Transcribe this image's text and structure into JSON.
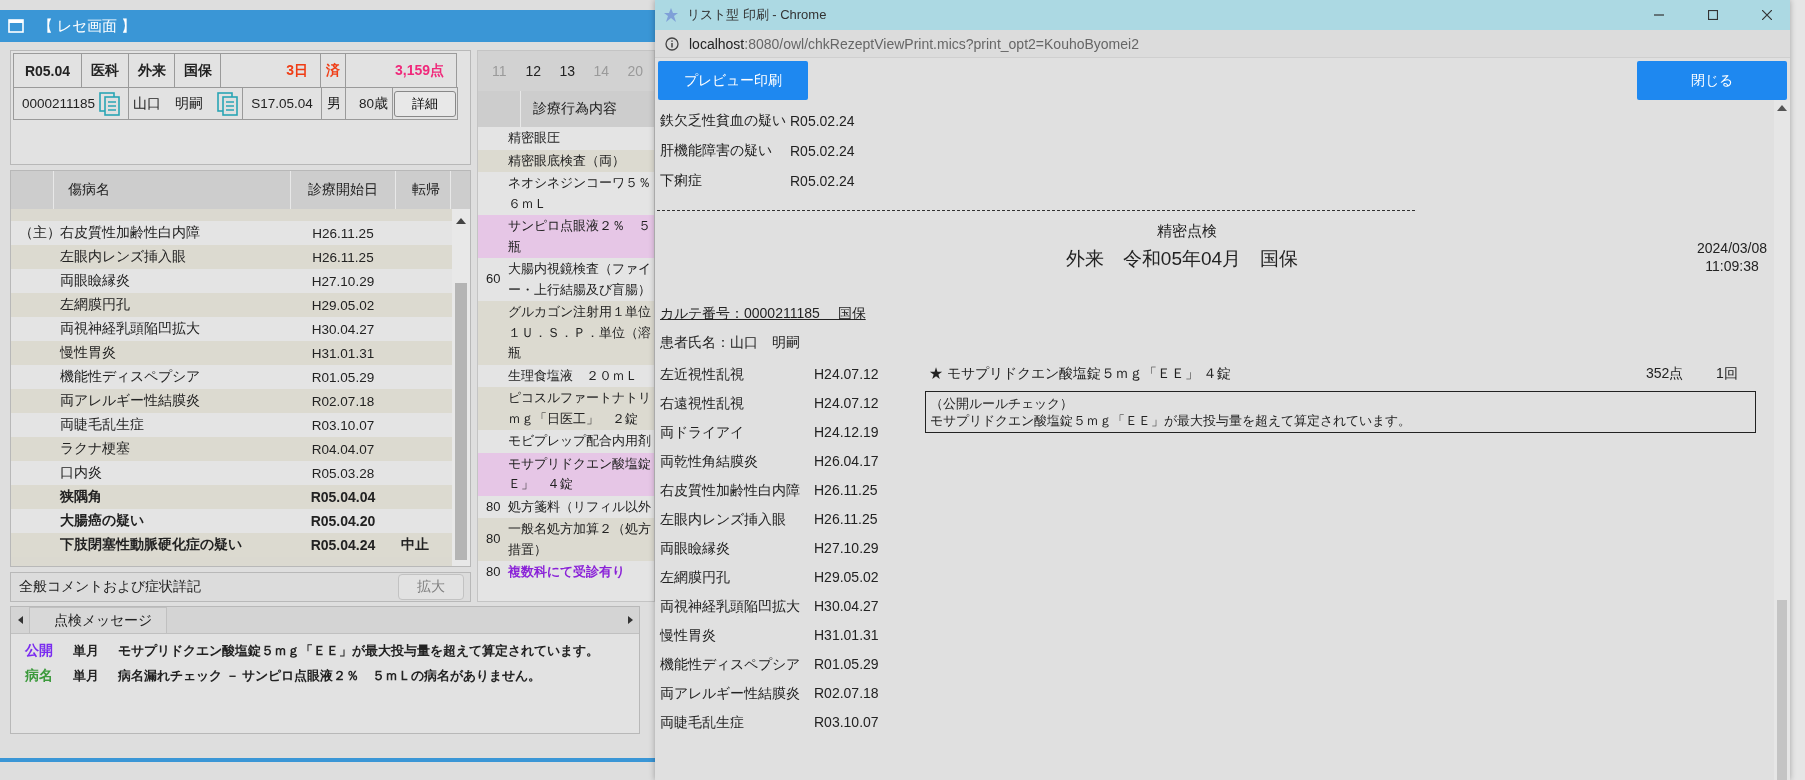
{
  "rece_window": {
    "title": "【 レセ画面 】",
    "header": {
      "month": "R05.04",
      "dept": "医科",
      "visit": "外来",
      "insurance": "国保",
      "days": "3日",
      "status": "済",
      "points": "3,159点",
      "patient_id": "0000211185",
      "patient_name": "山口　明嗣",
      "birth": "S17.05.04",
      "sex": "男",
      "age": "80歳",
      "detail_button": "詳細"
    },
    "diseases": {
      "columns": [
        "傷病名",
        "診療開始日",
        "転帰"
      ],
      "rows": [
        {
          "main": "（主）",
          "name": "右皮質性加齢性白内障",
          "start": "H26.11.25",
          "bold": false
        },
        {
          "name": "左眼内レンズ挿入眼",
          "start": "H26.11.25",
          "bold": false
        },
        {
          "name": "両眼瞼縁炎",
          "start": "H27.10.29",
          "bold": false
        },
        {
          "name": "左網膜円孔",
          "start": "H29.05.02",
          "bold": false
        },
        {
          "name": "両視神経乳頭陥凹拡大",
          "start": "H30.04.27",
          "bold": false
        },
        {
          "name": "慢性胃炎",
          "start": "H31.01.31",
          "bold": false
        },
        {
          "name": "機能性ディスペプシア",
          "start": "R01.05.29",
          "bold": false
        },
        {
          "name": "両アレルギー性結膜炎",
          "start": "R02.07.18",
          "bold": false
        },
        {
          "name": "両睫毛乱生症",
          "start": "R03.10.07",
          "bold": false
        },
        {
          "name": "ラクナ梗塞",
          "start": "R04.04.07",
          "bold": false
        },
        {
          "name": "口内炎",
          "start": "R05.03.28",
          "bold": false
        },
        {
          "name": "狭隅角",
          "start": "R05.04.04",
          "bold": true
        },
        {
          "name": "大腸癌の疑い",
          "start": "R05.04.20",
          "bold": true
        },
        {
          "name": "下肢閉塞性動脈硬化症の疑い",
          "start": "R05.04.24",
          "outcome": "中止",
          "bold": true
        }
      ]
    },
    "comment": {
      "label": "全般コメントおよび症状詳記",
      "button": "拡大",
      "disabled": true
    },
    "procedures": {
      "days": [
        {
          "label": "11",
          "active": false
        },
        {
          "label": "12",
          "active": true
        },
        {
          "label": "13",
          "active": true
        },
        {
          "label": "14",
          "active": false
        },
        {
          "label": "20",
          "active": false
        }
      ],
      "column": "診療行為内容",
      "items": [
        {
          "lines": [
            "精密眼圧"
          ],
          "highlighted": false,
          "emphasized": false
        },
        {
          "lines": [
            "精密眼底検査（両）"
          ],
          "highlighted": false,
          "emphasized": false
        },
        {
          "lines": [
            "ネオシネジンコーワ５％",
            "６ｍＬ"
          ],
          "highlighted": false,
          "emphasized": false
        },
        {
          "lines": [
            "サンピロ点眼液２％　５",
            "瓶"
          ],
          "highlighted": true,
          "emphasized": false
        },
        {
          "count": "60",
          "lines": [
            "大腸内視鏡検査（ファイ",
            "ー・上行結腸及び盲腸）"
          ],
          "highlighted": false,
          "emphasized": false
        },
        {
          "lines": [
            "グルカゴン注射用１単位",
            "１Ｕ．Ｓ．Ｐ．単位（溶",
            "瓶"
          ],
          "highlighted": false,
          "emphasized": false
        },
        {
          "lines": [
            "生理食塩液　２０ｍＬ"
          ],
          "highlighted": false,
          "emphasized": false
        },
        {
          "lines": [
            "ピコスルファートナトリ",
            "ｍｇ「日医工」　２錠"
          ],
          "highlighted": false,
          "emphasized": false
        },
        {
          "lines": [
            "モビプレップ配合内用剤"
          ],
          "highlighted": false,
          "emphasized": false
        },
        {
          "lines": [
            "モサプリドクエン酸塩錠",
            "Ｅ」　４錠"
          ],
          "highlighted": true,
          "emphasized": false
        },
        {
          "count": "80",
          "lines": [
            "処方箋料（リフィル以外"
          ],
          "highlighted": false,
          "emphasized": false
        },
        {
          "count": "80",
          "lines": [
            "一般名処方加算２（処方",
            "措置）"
          ],
          "highlighted": false,
          "emphasized": false
        },
        {
          "count": "80",
          "lines": [
            "複数科にて受診有り"
          ],
          "highlighted": false,
          "emphasized": true
        }
      ]
    },
    "messages": {
      "tab": "点検メッセージ",
      "items": [
        {
          "tag": "公開",
          "color": "#7a2cf0",
          "period": "単月",
          "text": "モサプリドクエン酸塩錠５ｍｇ「ＥＥ」が最大投与量を超えて算定されています。"
        },
        {
          "tag": "病名",
          "color": "#3c9a3c",
          "period": "単月",
          "text": "病名漏れチェック － サンピロ点眼液２％　５ｍＬの病名がありません。"
        }
      ]
    }
  },
  "print_window": {
    "title": "リスト型 印刷 - Chrome",
    "url_host": "localhost",
    "url_rest": ":8080/owl/chkRezeptViewPrint.mics?print_opt2=KouhoByomei2",
    "preview_button": "プレビュー印刷",
    "close_button": "閉じる",
    "earlier_diseases": [
      {
        "name": "鉄欠乏性貧血の疑い",
        "date": "R05.02.24"
      },
      {
        "name": "肝機能障害の疑い",
        "date": "R05.02.24"
      },
      {
        "name": "下痢症",
        "date": "R05.02.24"
      }
    ],
    "heading": "精密点検",
    "subheading": "外来　令和05年04月　国保",
    "print_date": "2024/03/08",
    "print_time": "11:09:38",
    "chart_number": "カルテ番号：0000211185　 国保",
    "patient": "患者氏名：山口　明嗣",
    "diseases": [
      {
        "name": "左近視性乱視",
        "date": "H24.07.12"
      },
      {
        "name": "右遠視性乱視",
        "date": "H24.07.12"
      },
      {
        "name": "両ドライアイ",
        "date": "H24.12.19"
      },
      {
        "name": "両乾性角結膜炎",
        "date": "H26.04.17"
      },
      {
        "name": "右皮質性加齢性白内障",
        "date": "H26.11.25"
      },
      {
        "name": "左眼内レンズ挿入眼",
        "date": "H26.11.25"
      },
      {
        "name": "両眼瞼縁炎",
        "date": "H27.10.29"
      },
      {
        "name": "左網膜円孔",
        "date": "H29.05.02"
      },
      {
        "name": "両視神経乳頭陥凹拡大",
        "date": "H30.04.27"
      },
      {
        "name": "慢性胃炎",
        "date": "H31.01.31"
      },
      {
        "name": "機能性ディスペプシア",
        "date": "R01.05.29"
      },
      {
        "name": "両アレルギー性結膜炎",
        "date": "R02.07.18"
      },
      {
        "name": "両睫毛乱生症",
        "date": "R03.10.07"
      }
    ],
    "findings": [
      {
        "item": "★ モサプリドクエン酸塩錠５ｍｇ「ＥＥ」 ４錠",
        "points": "352点",
        "times": "1回",
        "rule": "（公開ルールチェック）",
        "message": "モサプリドクエン酸塩錠５ｍｇ「ＥＥ」が最大投与量を超えて算定されています。"
      }
    ]
  }
}
